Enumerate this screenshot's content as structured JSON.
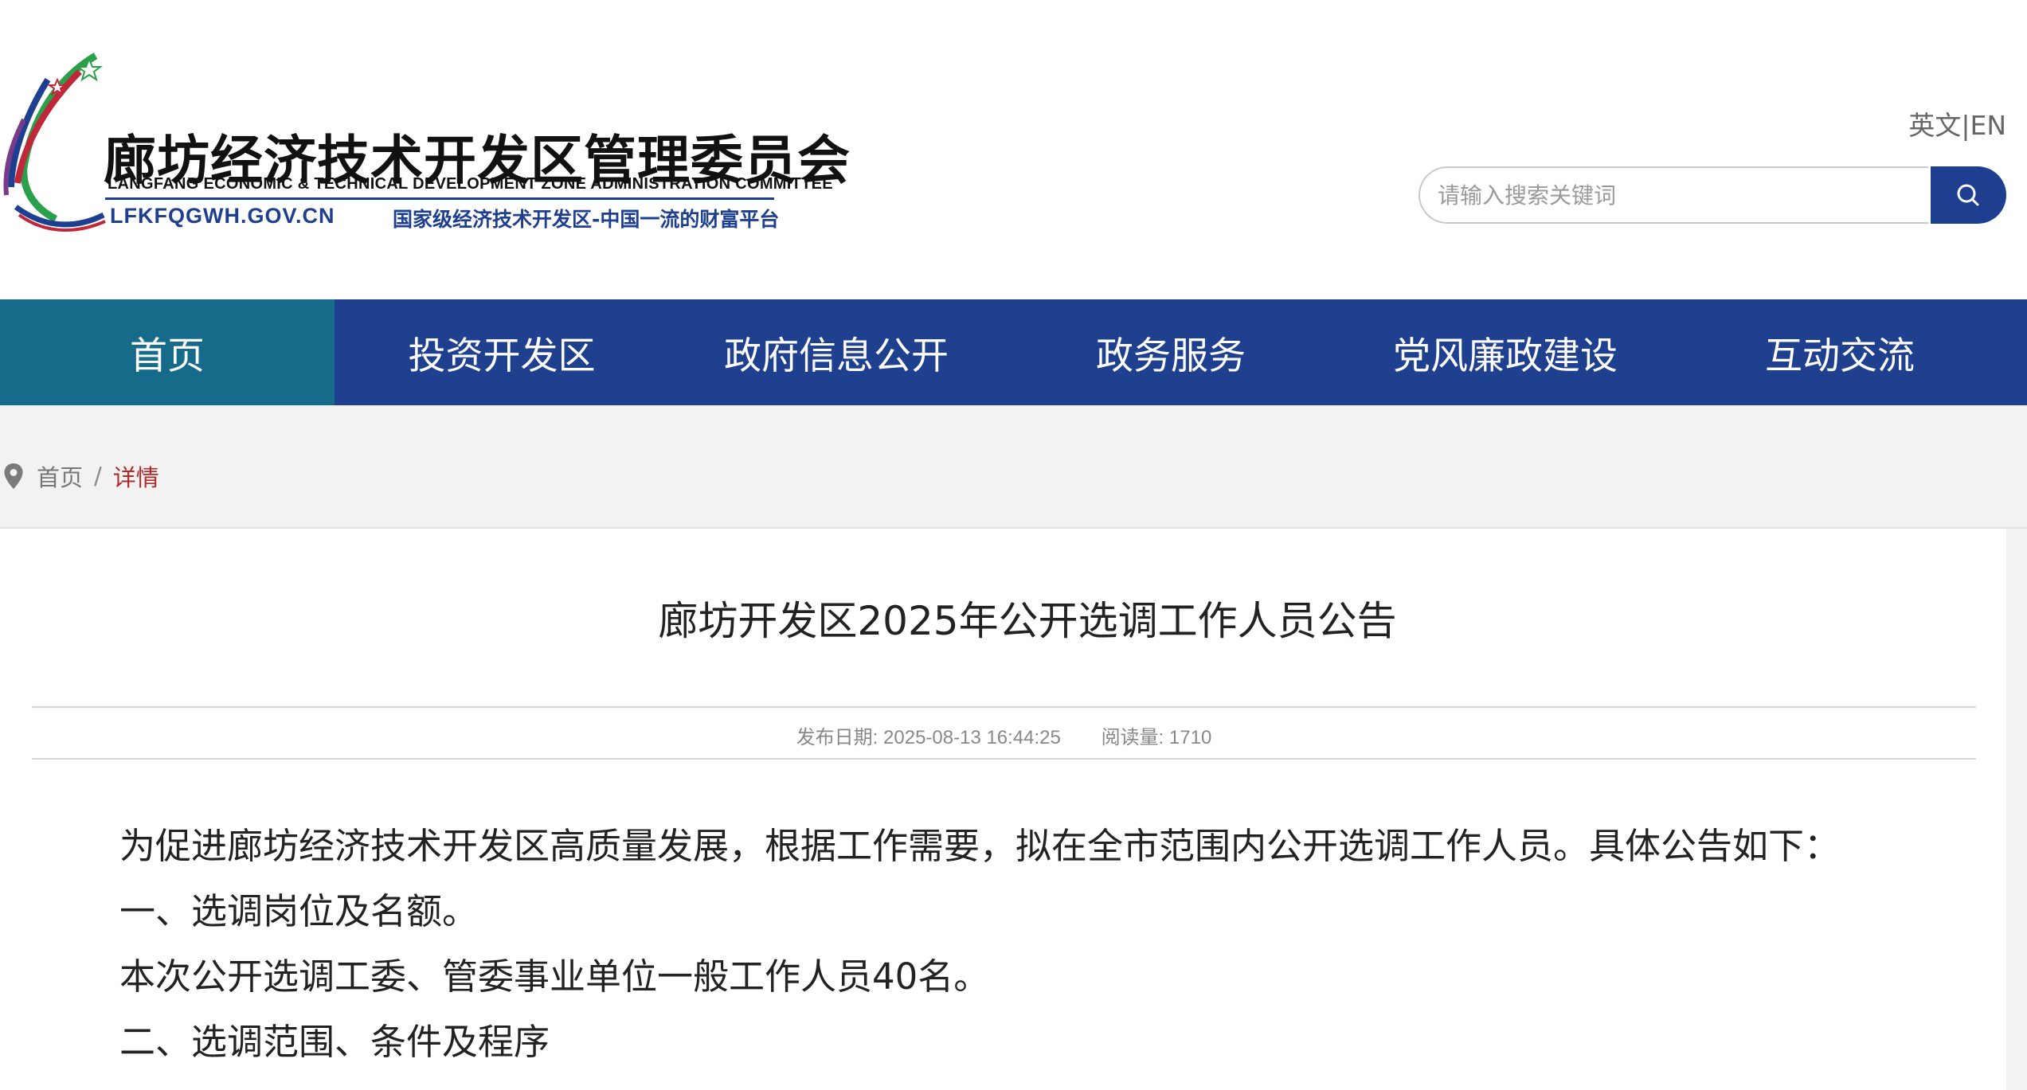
{
  "header": {
    "logo": {
      "title_cn": "廊坊经济技术开发区管理委员会",
      "title_en": "LANGFANG ECONOMIC & TECHNICAL DEVELOPMENT ZONE ADMINISTRATION COMMITTEE",
      "domain": "LFKFQGWH.GOV.CN",
      "slogan": "国家级经济技术开发区-中国一流的财富平台"
    },
    "lang_link": "英文|EN",
    "search": {
      "placeholder": "请输入搜索关键词",
      "value": "",
      "button_icon": "search-icon"
    }
  },
  "nav": {
    "items": [
      {
        "label": "首页",
        "active": true
      },
      {
        "label": "投资开发区"
      },
      {
        "label": "政府信息公开"
      },
      {
        "label": "政务服务"
      },
      {
        "label": "党风廉政建设"
      },
      {
        "label": "互动交流"
      }
    ]
  },
  "breadcrumb": {
    "icon": "location-pin-icon",
    "home": "首页",
    "separator": "/",
    "current": "详情"
  },
  "article": {
    "title": "廊坊开发区2025年公开选调工作人员公告",
    "publish_date": "发布日期: 2025-08-13 16:44:25",
    "read_count": "阅读量: 1710",
    "paragraphs": [
      "为促进廊坊经济技术开发区高质量发展，根据工作需要，拟在全市范围内公开选调工作人员。具体公告如下：",
      "一、选调岗位及名额。",
      "本次公开选调工委、管委事业单位一般工作人员40名。",
      "二、选调范围、条件及程序"
    ]
  },
  "colors": {
    "nav_bg": "#1f3f8f",
    "nav_active_bg": "#166a8a",
    "breadcrumb_current": "#b02a2a",
    "brand_blue": "#1e3f8f"
  }
}
